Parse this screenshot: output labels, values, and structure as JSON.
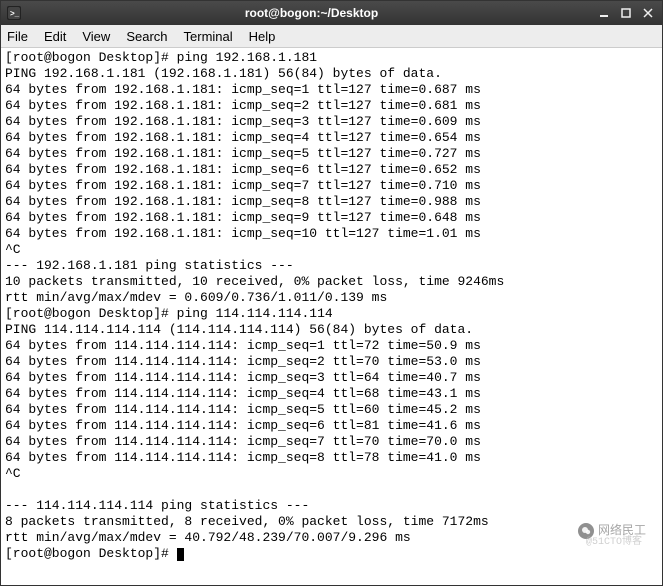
{
  "window": {
    "title": "root@bogon:~/Desktop"
  },
  "menu": {
    "file": "File",
    "edit": "Edit",
    "view": "View",
    "search": "Search",
    "terminal": "Terminal",
    "help": "Help"
  },
  "terminal": {
    "prompt": "[root@bogon Desktop]# ",
    "cmd1": "ping 192.168.1.181",
    "ping1_header": "PING 192.168.1.181 (192.168.1.181) 56(84) bytes of data.",
    "ping1_lines": [
      "64 bytes from 192.168.1.181: icmp_seq=1 ttl=127 time=0.687 ms",
      "64 bytes from 192.168.1.181: icmp_seq=2 ttl=127 time=0.681 ms",
      "64 bytes from 192.168.1.181: icmp_seq=3 ttl=127 time=0.609 ms",
      "64 bytes from 192.168.1.181: icmp_seq=4 ttl=127 time=0.654 ms",
      "64 bytes from 192.168.1.181: icmp_seq=5 ttl=127 time=0.727 ms",
      "64 bytes from 192.168.1.181: icmp_seq=6 ttl=127 time=0.652 ms",
      "64 bytes from 192.168.1.181: icmp_seq=7 ttl=127 time=0.710 ms",
      "64 bytes from 192.168.1.181: icmp_seq=8 ttl=127 time=0.988 ms",
      "64 bytes from 192.168.1.181: icmp_seq=9 ttl=127 time=0.648 ms",
      "64 bytes from 192.168.1.181: icmp_seq=10 ttl=127 time=1.01 ms"
    ],
    "ctrlc": "^C",
    "ping1_stats_header": "--- 192.168.1.181 ping statistics ---",
    "ping1_stats_l1": "10 packets transmitted, 10 received, 0% packet loss, time 9246ms",
    "ping1_stats_l2": "rtt min/avg/max/mdev = 0.609/0.736/1.011/0.139 ms",
    "cmd2": "ping 114.114.114.114",
    "ping2_header": "PING 114.114.114.114 (114.114.114.114) 56(84) bytes of data.",
    "ping2_lines": [
      "64 bytes from 114.114.114.114: icmp_seq=1 ttl=72 time=50.9 ms",
      "64 bytes from 114.114.114.114: icmp_seq=2 ttl=70 time=53.0 ms",
      "64 bytes from 114.114.114.114: icmp_seq=3 ttl=64 time=40.7 ms",
      "64 bytes from 114.114.114.114: icmp_seq=4 ttl=68 time=43.1 ms",
      "64 bytes from 114.114.114.114: icmp_seq=5 ttl=60 time=45.2 ms",
      "64 bytes from 114.114.114.114: icmp_seq=6 ttl=81 time=41.6 ms",
      "64 bytes from 114.114.114.114: icmp_seq=7 ttl=70 time=70.0 ms",
      "64 bytes from 114.114.114.114: icmp_seq=8 ttl=78 time=41.0 ms"
    ],
    "blank": "",
    "ping2_stats_header": "--- 114.114.114.114 ping statistics ---",
    "ping2_stats_l1": "8 packets transmitted, 8 received, 0% packet loss, time 7172ms",
    "ping2_stats_l2": "rtt min/avg/max/mdev = 40.792/48.239/70.007/9.296 ms"
  },
  "watermark": {
    "text": "网络民工",
    "sub": "@51CTO博客"
  }
}
